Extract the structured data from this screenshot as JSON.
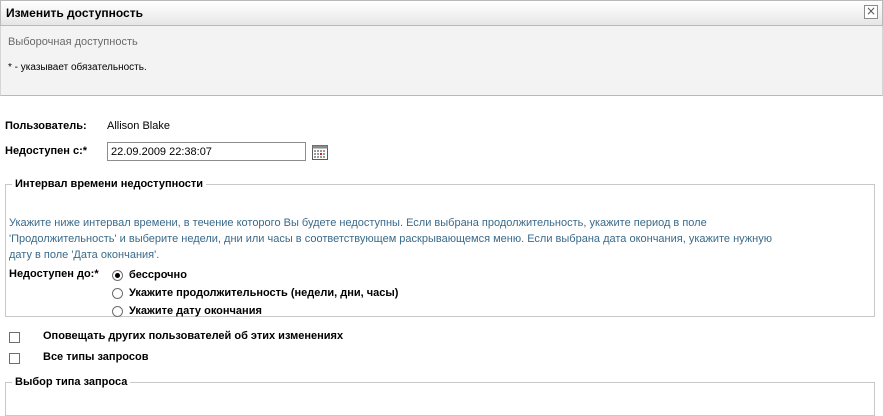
{
  "dialog": {
    "title": "Изменить доступность",
    "subtitle": "Выборочная доступность",
    "required_note": "* - указывает обязательность."
  },
  "form": {
    "user_label": "Пользователь:",
    "user_value": "Allison Blake",
    "unavailable_from_label": "Недоступен с:*",
    "unavailable_from_value": "22.09.2009 22:38:07"
  },
  "interval": {
    "legend": "Интервал времени недоступности",
    "info_line1": "Укажите ниже интервал времени, в течение которого Вы будете недоступны. Если выбрана продолжительность, укажите период в поле",
    "info_line2": "'Продолжительность' и выберите недели, дни или часы в соответствующем раскрывающемся меню. Если выбрана дата окончания, укажите нужную",
    "info_line3": "дату в поле 'Дата окончания'.",
    "until_label": "Недоступен до:*",
    "options": [
      {
        "label": "бессрочно",
        "checked": true
      },
      {
        "label": "Укажите продолжительность (недели, дни, часы)",
        "checked": false
      },
      {
        "label": "Укажите дату окончания",
        "checked": false
      }
    ]
  },
  "checks": {
    "notify_label": "Оповещать других пользователей об этих изменениях",
    "all_types_label": "Все типы запросов"
  },
  "request_type": {
    "legend": "Выбор типа запроса"
  }
}
